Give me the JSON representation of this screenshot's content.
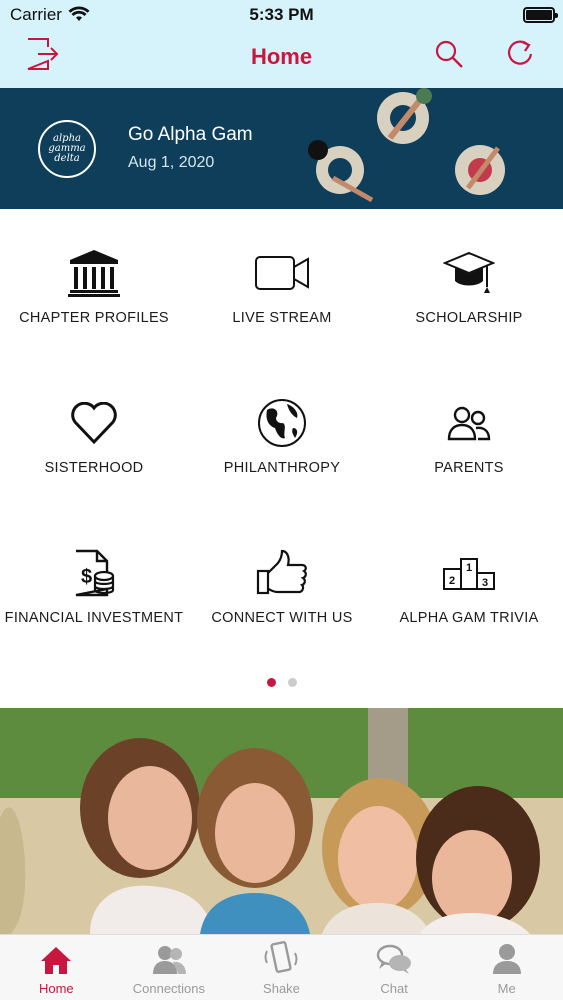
{
  "status_bar": {
    "carrier": "Carrier",
    "time": "5:33 PM"
  },
  "nav": {
    "title": "Home"
  },
  "banner": {
    "logo_text": "alpha gamma delta",
    "name": "Go Alpha Gam",
    "date": "Aug 1, 2020"
  },
  "grid": [
    {
      "label": "CHAPTER PROFILES",
      "icon": "building-columns-icon"
    },
    {
      "label": "LIVE STREAM",
      "icon": "video-camera-icon"
    },
    {
      "label": "SCHOLARSHIP",
      "icon": "graduation-cap-icon"
    },
    {
      "label": "SISTERHOOD",
      "icon": "heart-icon"
    },
    {
      "label": "PHILANTHROPY",
      "icon": "globe-icon"
    },
    {
      "label": "PARENTS",
      "icon": "people-icon"
    },
    {
      "label": "FINANCIAL INVESTMENT",
      "icon": "invoice-money-icon"
    },
    {
      "label": "CONNECT WITH US",
      "icon": "thumbs-up-icon"
    },
    {
      "label": "ALPHA GAM TRIVIA",
      "icon": "podium-icon"
    }
  ],
  "pager": {
    "pages": 2,
    "current": 1
  },
  "tabbar": {
    "items": [
      {
        "label": "Home",
        "icon": "home-icon",
        "active": true
      },
      {
        "label": "Connections",
        "icon": "connections-icon",
        "active": false
      },
      {
        "label": "Shake",
        "icon": "shake-phone-icon",
        "active": false
      },
      {
        "label": "Chat",
        "icon": "chat-bubbles-icon",
        "active": false
      },
      {
        "label": "Me",
        "icon": "person-icon",
        "active": false
      }
    ]
  },
  "colors": {
    "accent": "#c8173f",
    "banner": "#0e3e5a",
    "nav_bg": "#d6f3fb"
  }
}
